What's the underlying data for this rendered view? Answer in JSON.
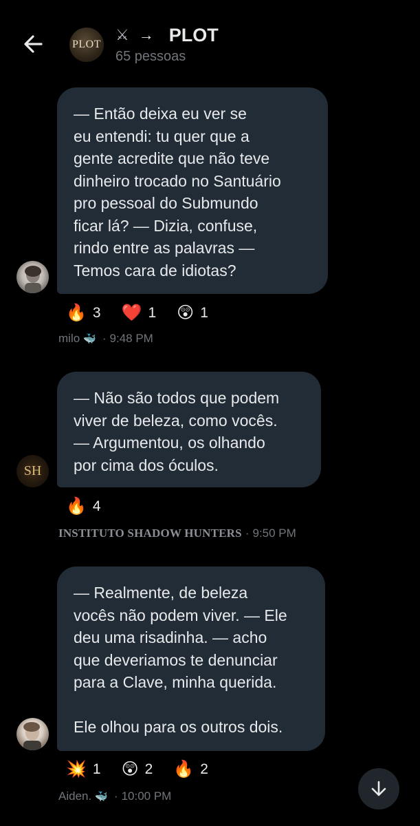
{
  "header": {
    "back_icon": "arrow-left-icon",
    "avatar_text": "PLOT",
    "title_prefix_icons": [
      "crossed-swords-icon",
      "arrow-right-icon"
    ],
    "title": "PLOT",
    "member_count": "65 pessoas"
  },
  "messages": [
    {
      "text": "— Então deixa eu ver se\neu entendi: tu quer que a\ngente acredite que não teve\ndinheiro trocado no Santuário\npro pessoal do Submundo\nficar lá? — Dizia, confuse,\nrindo entre as palavras —\nTemos cara de idiotas?",
      "reactions": [
        {
          "emoji": "🔥",
          "count": "3"
        },
        {
          "emoji": "❤️",
          "count": "1"
        },
        {
          "emoji": "😲",
          "count": "1"
        }
      ],
      "sender": "milo",
      "sender_badge": "🐳",
      "separator": "·",
      "time": "9:48 PM"
    },
    {
      "text": "— Não são todos que podem\nviver de beleza, como vocês.\n— Argumentou, os olhando\npor cima dos óculos.",
      "avatar_text": "SH",
      "reactions": [
        {
          "emoji": "🔥",
          "count": "4"
        }
      ],
      "sender": "INSTITUTO SHADOW HUNTERS",
      "separator": "·",
      "time": "9:50 PM"
    },
    {
      "text": "— Realmente, de beleza\nvocês não podem viver. — Ele\ndeu uma risadinha. — acho\nque deveriamos te denunciar\npara a Clave, minha querida.\n\nEle olhou para os outros dois.",
      "reactions": [
        {
          "emoji": "💥",
          "count": "1"
        },
        {
          "emoji": "😲",
          "count": "2"
        },
        {
          "emoji": "🔥",
          "count": "2"
        }
      ],
      "sender": "Aiden.",
      "sender_badge": "🐳",
      "separator": "·",
      "time": "10:00 PM"
    }
  ],
  "scroll_button_icon": "arrow-down-icon",
  "colors": {
    "background": "#000000",
    "bubble": "#212c36",
    "text": "#e7e9ea",
    "muted": "#71767b"
  }
}
